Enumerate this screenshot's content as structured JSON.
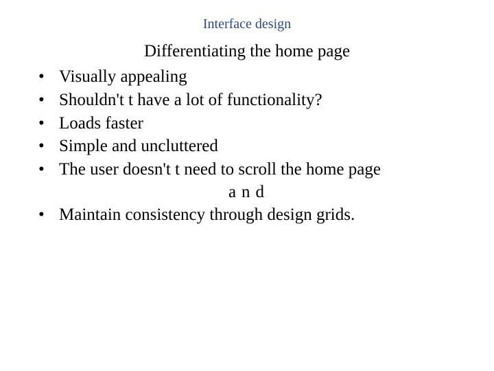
{
  "header": {
    "label": "Interface design"
  },
  "title": "Differentiating the home page",
  "bullets_top": [
    "Visually appealing",
    "Shouldn't t have a lot of functionality?",
    "Loads faster",
    "Simple and uncluttered",
    "The user doesn't t need to scroll the home page"
  ],
  "connector": "and",
  "bullets_bottom": [
    "Maintain consistency through design grids."
  ]
}
